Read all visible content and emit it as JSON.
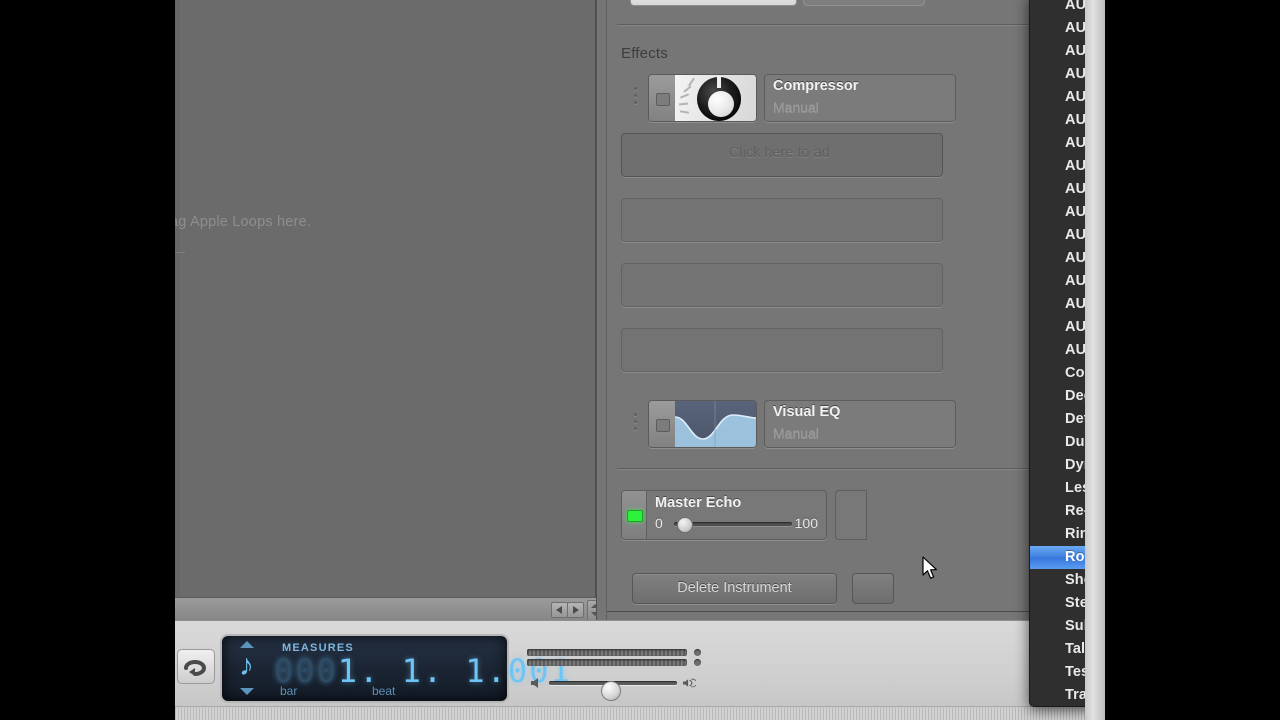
{
  "window": {
    "loop_browser_hint": "ag Apple Loops here.",
    "section_title": "Effects"
  },
  "effects": {
    "slots": [
      {
        "name": "Compressor",
        "preset": "Manual",
        "icon": "compressor-knob-icon",
        "enabled": false
      },
      {
        "name": "Visual EQ",
        "preset": "Manual",
        "icon": "eq-curve-icon",
        "enabled": false
      }
    ],
    "add_effect_hint": "Click here to ad",
    "empty_slot_count": 3
  },
  "sends": {
    "master_echo": {
      "label": "Master Echo",
      "min": "0",
      "max": "100",
      "value": 3,
      "led": "on"
    }
  },
  "footer": {
    "delete_instrument_label": "Delete Instrument"
  },
  "transport": {
    "cycle_icon": "cycle-icon",
    "lcd": {
      "mode_label": "MEASURES",
      "note_icon": "eighth-note-icon",
      "leading_zeros": "000",
      "value": "1. 1. 1.001",
      "bar_label": "bar",
      "beat_label": "beat",
      "up_icon": "triangle-up-icon",
      "down_icon": "triangle-down-icon"
    },
    "volume": {
      "speaker_low_icon": "speaker-low-icon",
      "speaker_high_icon": "speaker-high-icon",
      "position_pct": 47
    }
  },
  "menu": {
    "name": "effect-plugin-menu",
    "selected": "Round Pan",
    "highlight_color": "#3d7fe0",
    "items": [
      "AUDistortion",
      "AUDynamicsProcessor",
      "AUFilter",
      "AUGraphicEQ",
      "AUHighShelfFilter",
      "AUHipass",
      "AULowpass",
      "AULowShelfFilter",
      "AUMatrixReverb",
      "AUMultibandCompressor",
      "AUNetSend",
      "AUParametricEQ",
      "AUPeakLimiter",
      "AUPitch",
      "AURogerBeep",
      "AUSampleDelay",
      "Combo",
      "Degrade",
      "Detune",
      "Dub Delay",
      "Dynamics",
      "Leslie",
      "Re-Psycho!",
      "Ring Mod",
      "Round Pan",
      "Shepard Tones",
      "Stereo Simulator",
      "Sub-Bass Synthesizer",
      "Talkbox",
      "Test Tone",
      "Tracker"
    ]
  },
  "colors": {
    "menu_background": "#2f2f2f",
    "menu_text": "#e9e9e9",
    "panel_background": "#767676",
    "led_green": "#2cf23c",
    "lcd_blue": "#6ec4f5"
  }
}
